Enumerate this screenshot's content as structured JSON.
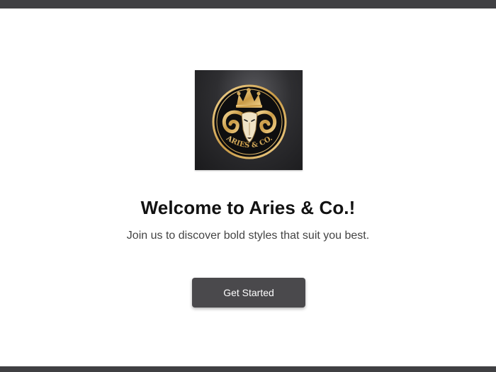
{
  "brand": {
    "logo_text": "ARIES & CO.",
    "logo_icon": "ram-crown-emblem-icon"
  },
  "welcome": {
    "title": "Welcome to Aries & Co.!",
    "subtitle": "Join us to discover bold styles that suit you best."
  },
  "actions": {
    "get_started_label": "Get Started"
  },
  "colors": {
    "chrome_bar": "#404043",
    "button_bg": "#4a494c",
    "button_text": "#ffffff",
    "gold": "#d9b56a",
    "title_text": "#121212",
    "subtitle_text": "#444444"
  }
}
